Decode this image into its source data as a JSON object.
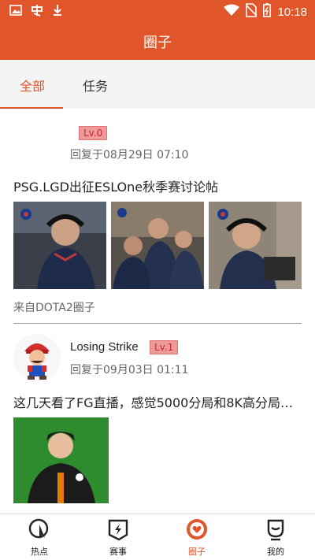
{
  "statusbar": {
    "time": "10:18",
    "icons": [
      "image-icon",
      "app-icon",
      "download-icon",
      "wifi-icon",
      "no-sim-icon",
      "battery-icon"
    ]
  },
  "appbar": {
    "title": "圈子"
  },
  "tabs": [
    {
      "label": "全部",
      "active": true
    },
    {
      "label": "任务",
      "active": false
    }
  ],
  "posts": [
    {
      "username": "",
      "level": "Lv.0",
      "reply_time": "回复于08月29日 07:10",
      "title": "PSG.LGD出征ESLOne秋季赛讨论帖",
      "image_count": 3,
      "source": "来自DOTA2圈子"
    },
    {
      "username": "Losing Strike",
      "level": "Lv.1",
      "reply_time": "回复于09月03日 01:11",
      "title": "这几天看了FG直播，感觉5000分局和8K高分局…",
      "image_count": 1
    }
  ],
  "bottom_nav": [
    {
      "label": "热点",
      "icon": "hot-icon",
      "active": false
    },
    {
      "label": "赛事",
      "icon": "match-icon",
      "active": false
    },
    {
      "label": "圈子",
      "icon": "circle-heart-icon",
      "active": true
    },
    {
      "label": "我的",
      "icon": "profile-icon",
      "active": false
    }
  ],
  "colors": {
    "accent": "#e0552a",
    "badge_bg": "#ef9a9a",
    "badge_text": "#c62828"
  }
}
